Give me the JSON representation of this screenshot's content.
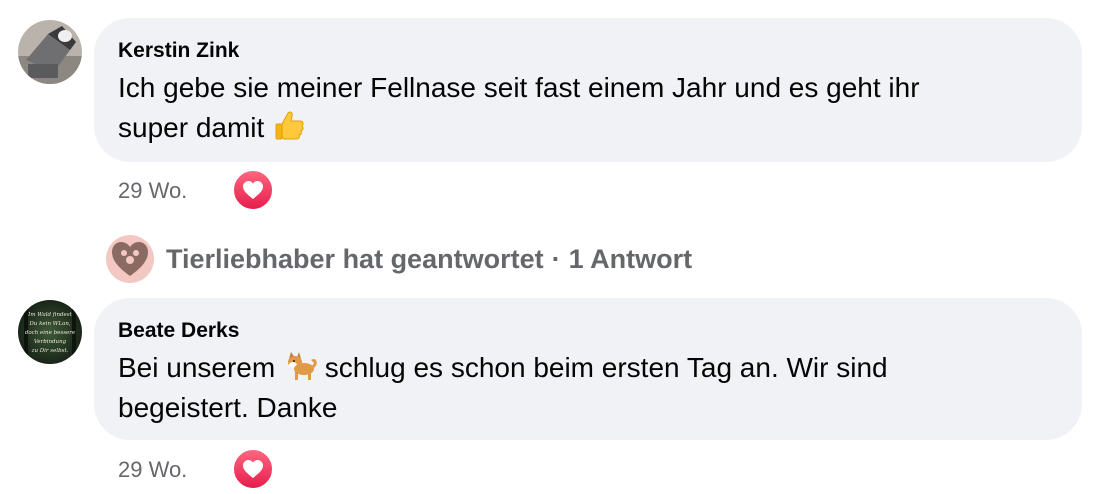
{
  "comments": [
    {
      "author": "Kerstin Zink",
      "text_line1": "Ich gebe sie meiner Fellnase seit fast einem Jahr und es geht ihr",
      "text_line2_prefix": "super damit",
      "emoji": "thumbs-up-icon",
      "time": "29 Wo.",
      "reaction": "love-reaction-icon"
    },
    {
      "author": "Beate Derks",
      "text_before_emoji": "Bei unserem",
      "emoji": "dog-icon",
      "text_after_emoji": "schlug es schon beim ersten Tag an. Wir sind",
      "text_line2": "begeistert. Danke",
      "time": "29 Wo.",
      "reaction": "love-reaction-icon",
      "avatar_caption": "Im Wald findest Du kein WLan, doch eine bessere Verbindung zu Dir selbst."
    }
  ],
  "replies": {
    "replier": "Tierliebhaber hat geantwortet",
    "separator": "·",
    "count": "1 Antwort"
  },
  "colors": {
    "bubble": "#f0f2f5",
    "secondary_text": "#65676b",
    "love": "#f33e58"
  }
}
